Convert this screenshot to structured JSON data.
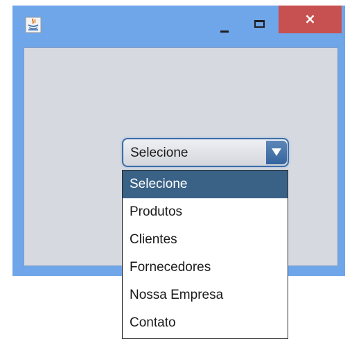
{
  "window": {
    "close_glyph": "×",
    "colors": {
      "frame": "#6fa5e9",
      "close": "#c75050",
      "content": "#d6d9df"
    }
  },
  "combo": {
    "selected": "Selecione",
    "options": [
      "Selecione",
      "Produtos",
      "Clientes",
      "Fornecedores",
      "Nossa Empresa",
      "Contato"
    ],
    "highlighted_index": 0,
    "colors": {
      "highlight": "#3a6287"
    }
  }
}
